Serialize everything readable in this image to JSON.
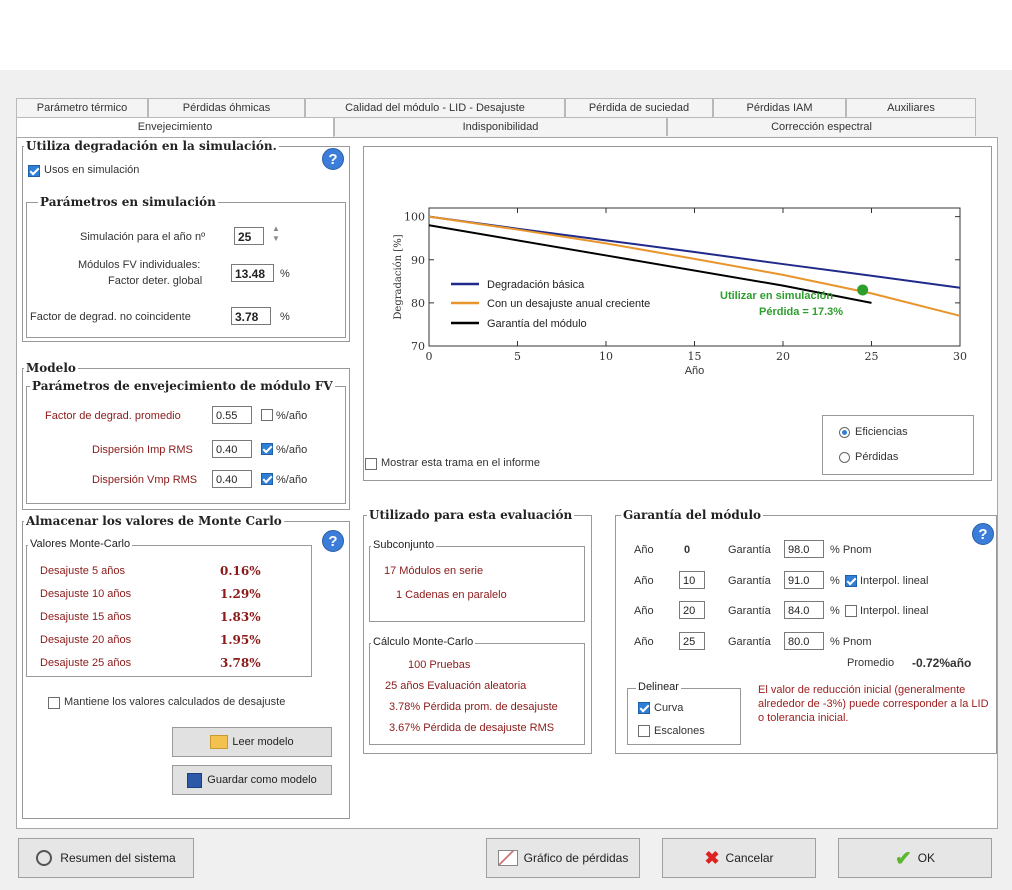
{
  "tabs_row1": [
    "Parámetro térmico",
    "Pérdidas óhmicas",
    "Calidad del módulo - LID - Desajuste",
    "Pérdida de suciedad",
    "Pérdidas IAM",
    "Auxiliares"
  ],
  "tabs_row2": [
    "Envejecimiento",
    "Indisponibilidad",
    "Corrección espectral"
  ],
  "degradation": {
    "title": "Utiliza degradación en la simulación.",
    "use_checkbox": "Usos en simulación",
    "params_title": "Parámetros en simulación",
    "year_label": "Simulación para el año nº",
    "year_value": "25",
    "individual_label1": "Módulos FV individuales:",
    "individual_label2": "Factor deter. global",
    "global_factor": "13.48",
    "pct": "%",
    "noncoincident_label": "Factor de degrad. no coincidente",
    "noncoincident_value": "3.78"
  },
  "model": {
    "title": "Modelo",
    "params_title": "Parámetros de envejecimiento de módulo FV",
    "avg_label": "Factor de degrad. promedio",
    "avg_value": "0.55",
    "imp_label": "Dispersión Imp RMS",
    "imp_value": "0.40",
    "vmp_label": "Dispersión Vmp RMS",
    "vmp_value": "0.40",
    "unit": "%/año"
  },
  "montecarlo": {
    "title": "Almacenar los valores de Monte Carlo",
    "subtitle": "Valores Monte-Carlo",
    "rows": [
      {
        "label": "Desajuste  5 años",
        "value": "0.16%"
      },
      {
        "label": "Desajuste 10 años",
        "value": "1.29%"
      },
      {
        "label": "Desajuste 15 años",
        "value": "1.83%"
      },
      {
        "label": "Desajuste 20 años",
        "value": "1.95%"
      },
      {
        "label": "Desajuste 25 años",
        "value": "3.78%"
      }
    ],
    "keep_label": "Mantiene los valores calculados de desajuste",
    "load_button": "Leer modelo",
    "save_button": "Guardar como modelo"
  },
  "chart_data": {
    "type": "line",
    "xlabel": "Año",
    "ylabel": "Degradación [%]",
    "xlim": [
      0,
      30
    ],
    "ylim": [
      70,
      102
    ],
    "xticks": [
      0,
      5,
      10,
      15,
      20,
      25,
      30
    ],
    "yticks": [
      70,
      80,
      90,
      100
    ],
    "series": [
      {
        "name": "Degradación básica",
        "color": "#1f2a8a",
        "x": [
          0,
          5,
          10,
          15,
          20,
          25,
          30
        ],
        "y": [
          100,
          97.2,
          94.5,
          91.8,
          89.0,
          86.3,
          83.5
        ]
      },
      {
        "name": "Con un desajuste anual creciente",
        "color": "#e8952c",
        "x": [
          0,
          5,
          10,
          15,
          20,
          25,
          30
        ],
        "y": [
          100,
          97.0,
          93.8,
          90.2,
          86.5,
          82.2,
          77.0
        ]
      },
      {
        "name": "Garantía del módulo",
        "color": "#000000",
        "x": [
          0,
          10,
          20,
          25
        ],
        "y": [
          98,
          91,
          84,
          80
        ]
      }
    ],
    "marker": {
      "x": 24.5,
      "y": 83,
      "color": "#2e9e2e"
    },
    "annotation1": "Utilizar en simulación",
    "annotation2": "Pérdida = 17.3%"
  },
  "chart_options": {
    "show_in_report": "Mostrar esta trama en el informe",
    "radio_eff": "Eficiencias",
    "radio_loss": "Pérdidas"
  },
  "evaluation": {
    "title": "Utilizado para esta evaluación",
    "subset_title": "Subconjunto",
    "modules": "17  Módulos en serie",
    "strings": "1  Cadenas en paralelo",
    "mc_title": "Cálculo Monte-Carlo",
    "trials": "100 Pruebas",
    "years_eval": "25 años  Evaluación aleatoria",
    "avg_loss": "3.78%  Pérdida prom. de desajuste",
    "rms_loss": "3.67%  Pérdida de desajuste RMS"
  },
  "warranty": {
    "title": "Garantía del módulo",
    "year_label": "Año",
    "guarantee_label": "Garantía",
    "rows": [
      {
        "year": "0",
        "value": "98.0",
        "suffix": "% Pnom"
      },
      {
        "year": "10",
        "value": "91.0",
        "suffix": "Interpol. lineal"
      },
      {
        "year": "20",
        "value": "84.0",
        "suffix": "Interpol. lineal"
      },
      {
        "year": "25",
        "value": "80.0",
        "suffix": "% Pnom"
      }
    ],
    "pct": "%",
    "avg_label": "Promedio",
    "avg_value": "-0.72%año",
    "draw_title": "Delinear",
    "curve": "Curva",
    "steps": "Escalones",
    "note": "El valor de reducción inicial (generalmente alrededor de -3%) puede corresponder a la LID o tolerancia inicial."
  },
  "footer": {
    "summary": "Resumen del sistema",
    "loss_graph": "Gráfico de pérdidas",
    "cancel": "Cancelar",
    "ok": "OK"
  }
}
